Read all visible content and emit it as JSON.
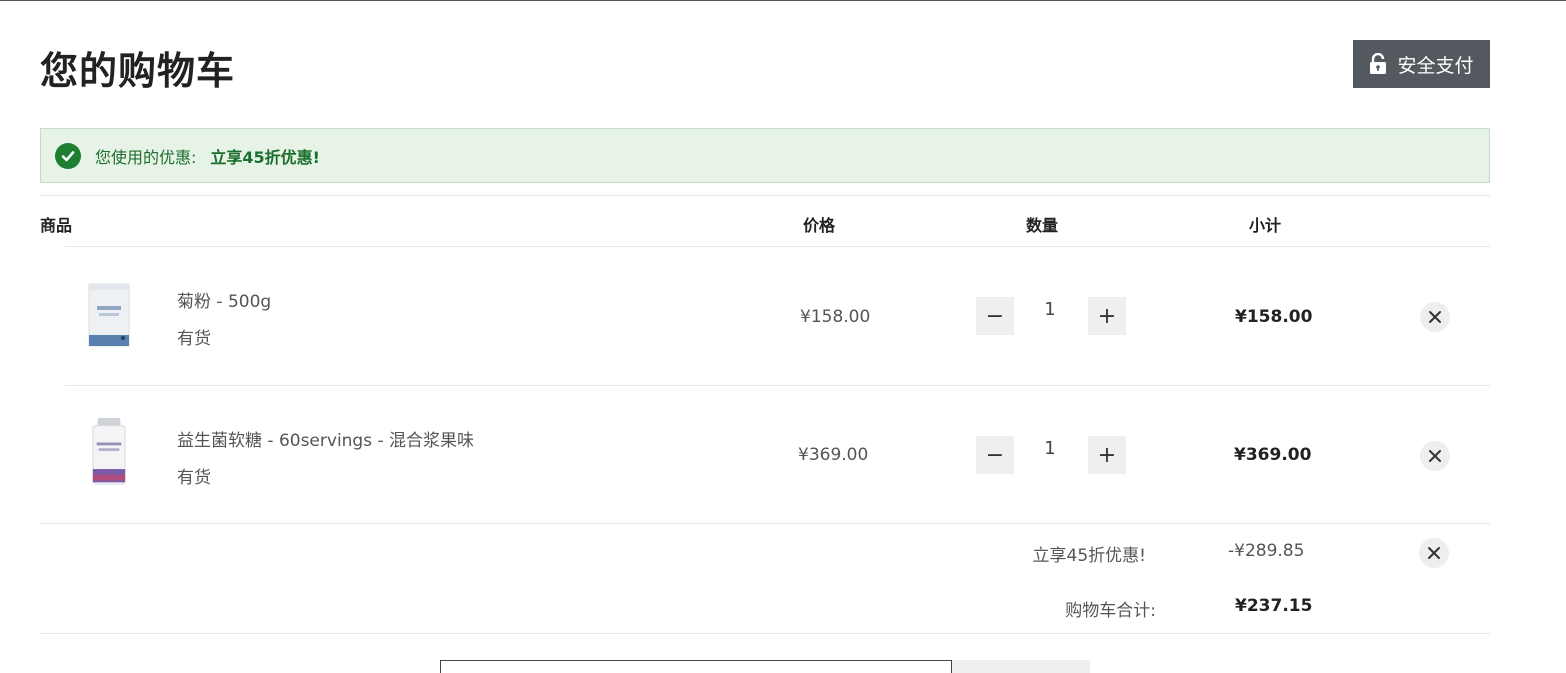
{
  "header": {
    "title": "您的购物车",
    "secure_pay_label": "安全支付"
  },
  "promo": {
    "message": "您使用的优惠:",
    "code": "立享45折优惠!"
  },
  "table": {
    "headers": {
      "product": "商品",
      "price": "价格",
      "quantity": "数量",
      "subtotal": "小计"
    }
  },
  "items": [
    {
      "name": "菊粉 - 500g",
      "stock": "有货",
      "price": "¥158.00",
      "quantity": "1",
      "subtotal": "¥158.00",
      "decrease_label": "−",
      "increase_label": "+"
    },
    {
      "name": "益生菌软糖 - 60servings - 混合浆果味",
      "stock": "有货",
      "price": "¥369.00",
      "quantity": "1",
      "subtotal": "¥369.00",
      "decrease_label": "−",
      "increase_label": "+"
    }
  ],
  "summary": {
    "discount_label": "立享45折优惠!",
    "discount_value": "-¥289.85",
    "total_label": "购物车合计:",
    "total_value": "¥237.15"
  },
  "colors": {
    "secure_button_bg": "#545960",
    "promo_bg": "#e7f3e7",
    "promo_accent": "#1e7e32"
  }
}
